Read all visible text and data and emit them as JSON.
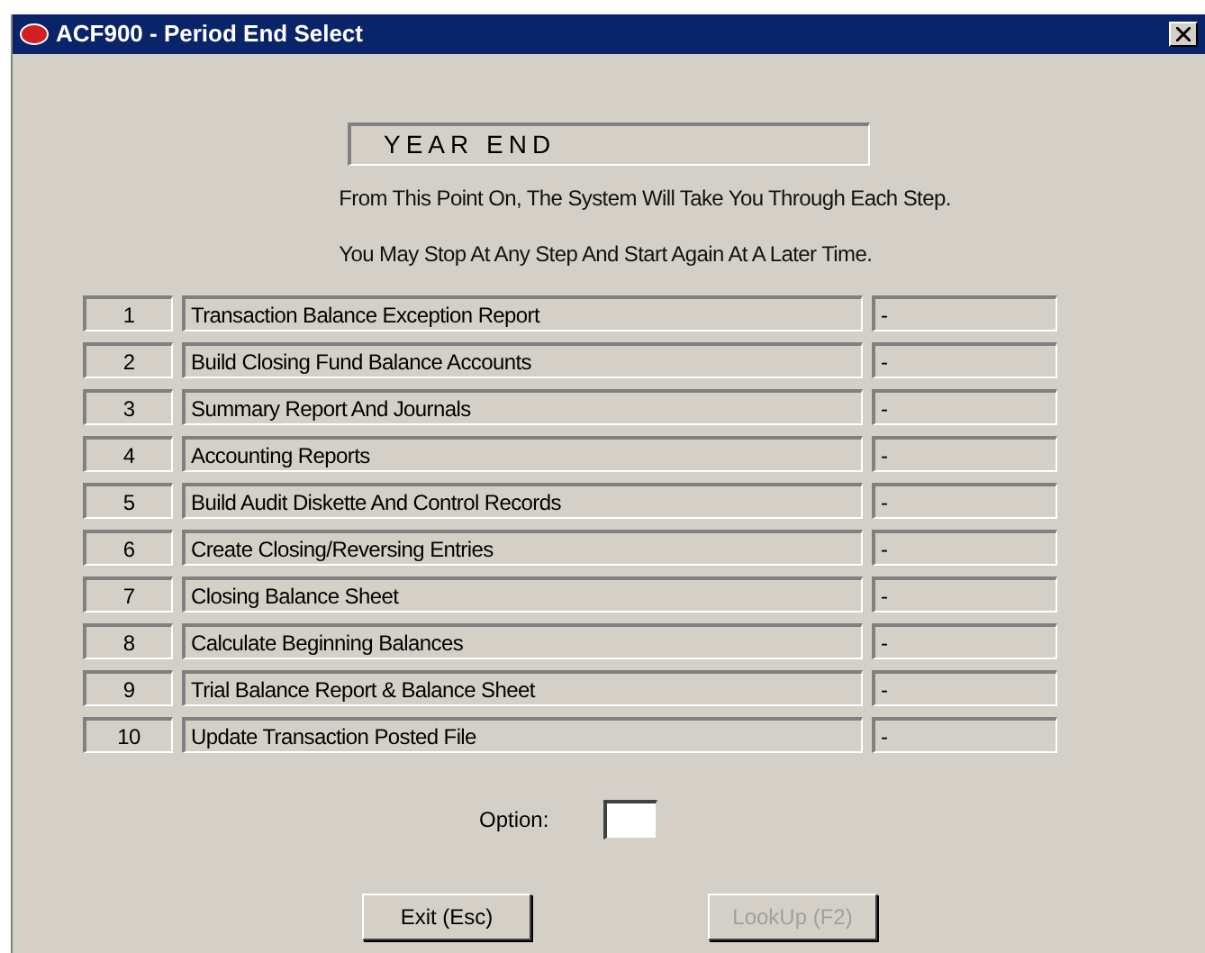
{
  "window": {
    "title": "ACF900 - Period End Select"
  },
  "heading": "YEAR END",
  "instructions": [
    "From This Point On, The System Will Take You Through Each Step.",
    "You May Stop At Any Step And Start Again At A Later Time."
  ],
  "steps": [
    {
      "number": "1",
      "name": "Transaction Balance Exception Report",
      "status": "-"
    },
    {
      "number": "2",
      "name": "Build Closing Fund Balance Accounts",
      "status": "-"
    },
    {
      "number": "3",
      "name": "Summary Report And Journals",
      "status": "-"
    },
    {
      "number": "4",
      "name": "Accounting Reports",
      "status": "-"
    },
    {
      "number": "5",
      "name": "Build Audit Diskette And Control Records",
      "status": "-"
    },
    {
      "number": "6",
      "name": "Create Closing/Reversing Entries",
      "status": "-"
    },
    {
      "number": "7",
      "name": "Closing Balance Sheet",
      "status": "-"
    },
    {
      "number": "8",
      "name": "Calculate Beginning Balances",
      "status": "-"
    },
    {
      "number": "9",
      "name": "Trial Balance Report & Balance Sheet",
      "status": "-"
    },
    {
      "number": "10",
      "name": "Update Transaction Posted File",
      "status": "-"
    }
  ],
  "option": {
    "label": "Option:"
  },
  "buttons": [
    {
      "label": "Exit (Esc)",
      "disabled": false
    },
    {
      "label": "LookUp (F2)",
      "disabled": true
    }
  ]
}
